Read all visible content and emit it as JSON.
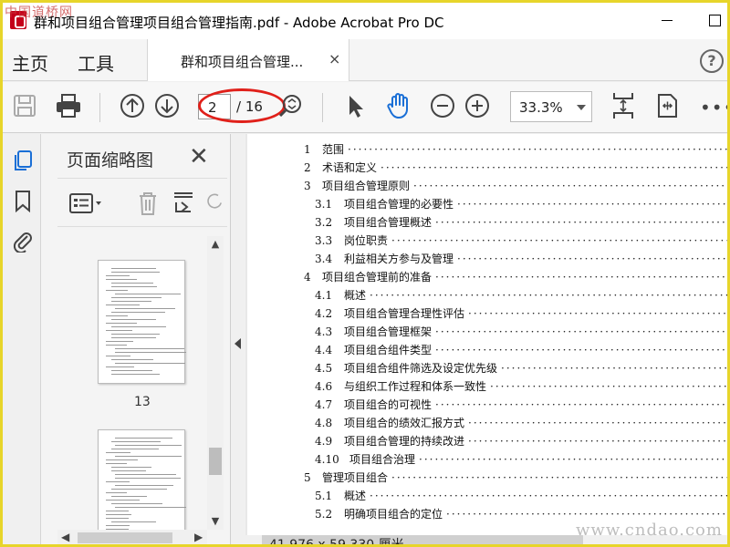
{
  "window": {
    "title": "群和项目组合管理项目组合管理指南.pdf - Adobe Acrobat Pro DC",
    "watermark_top": "中国道桥网",
    "watermark_bottom": "www.cndao.com"
  },
  "nav": {
    "home_label": "主页",
    "tools_label": "工具",
    "doc_tab_label": "群和项目组合管理...",
    "doc_tab_close": "×",
    "help": "?"
  },
  "toolbar": {
    "current_page": "2",
    "total_pages": "/ 16",
    "zoom": "33.3%",
    "more": "•••",
    "annotation_color": "#e0201a"
  },
  "thumbnail_panel": {
    "title": "页面缩略图",
    "close": "✕",
    "pages": [
      {
        "label": "13"
      },
      {
        "label": ""
      }
    ]
  },
  "document": {
    "toc": [
      {
        "num": "1",
        "text": "范围",
        "level": 1
      },
      {
        "num": "2",
        "text": "术语和定义",
        "level": 1
      },
      {
        "num": "3",
        "text": "项目组合管理原则",
        "level": 1
      },
      {
        "num": "3.1",
        "text": "项目组合管理的必要性",
        "level": 2
      },
      {
        "num": "3.2",
        "text": "项目组合管理概述",
        "level": 2
      },
      {
        "num": "3.3",
        "text": "岗位职责",
        "level": 2
      },
      {
        "num": "3.4",
        "text": "利益相关方参与及管理",
        "level": 2
      },
      {
        "num": "4",
        "text": "项目组合管理前的准备",
        "level": 1
      },
      {
        "num": "4.1",
        "text": "概述",
        "level": 2
      },
      {
        "num": "4.2",
        "text": "项目组合管理合理性评估",
        "level": 2
      },
      {
        "num": "4.3",
        "text": "项目组合管理框架",
        "level": 2
      },
      {
        "num": "4.4",
        "text": "项目组合组件类型",
        "level": 2
      },
      {
        "num": "4.5",
        "text": "项目组合组件筛选及设定优先级",
        "level": 2
      },
      {
        "num": "4.6",
        "text": "与组织工作过程和体系一致性",
        "level": 2
      },
      {
        "num": "4.7",
        "text": "项目组合的可视性",
        "level": 2
      },
      {
        "num": "4.8",
        "text": "项目组合的绩效汇报方式",
        "level": 2
      },
      {
        "num": "4.9",
        "text": "项目组合管理的持续改进",
        "level": 2
      },
      {
        "num": "4.10",
        "text": "项目组合治理",
        "level": 2
      },
      {
        "num": "5",
        "text": "管理项目组合",
        "level": 1
      },
      {
        "num": "5.1",
        "text": "概述",
        "level": 2
      },
      {
        "num": "5.2",
        "text": "明确项目组合的定位",
        "level": 2
      }
    ],
    "page_size": "41.976 x 59.330 厘米"
  }
}
